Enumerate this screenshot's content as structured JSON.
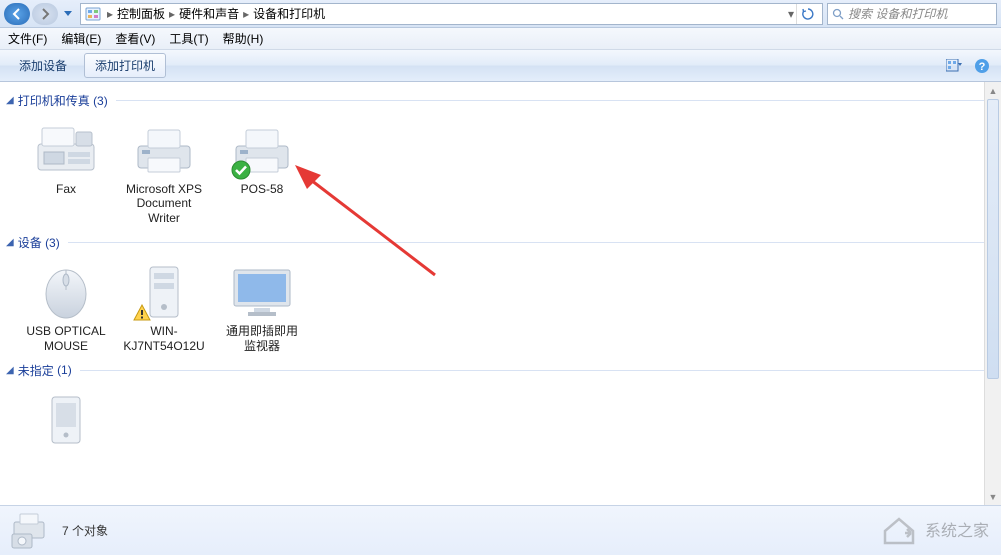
{
  "titlebar": {
    "breadcrumbs": [
      "控制面板",
      "硬件和声音",
      "设备和打印机"
    ],
    "search_placeholder": "搜索 设备和打印机"
  },
  "menubar": {
    "file": "文件(F)",
    "edit": "编辑(E)",
    "view": "查看(V)",
    "tools": "工具(T)",
    "help": "帮助(H)"
  },
  "toolbar": {
    "add_device": "添加设备",
    "add_printer": "添加打印机"
  },
  "groups": {
    "printers": {
      "title": "打印机和传真",
      "count": "(3)"
    },
    "devices": {
      "title": "设备",
      "count": "(3)"
    },
    "unspecified": {
      "title": "未指定",
      "count": "(1)"
    }
  },
  "items": {
    "printers": [
      {
        "label": "Fax",
        "icon": "fax",
        "default": false
      },
      {
        "label": "Microsoft XPS Document Writer",
        "icon": "printer",
        "default": false
      },
      {
        "label": "POS-58",
        "icon": "printer",
        "default": true
      }
    ],
    "devices": [
      {
        "label": "USB OPTICAL MOUSE",
        "icon": "mouse",
        "warn": false
      },
      {
        "label": "WIN-KJ7NT54O12U",
        "icon": "pc",
        "warn": true
      },
      {
        "label": "通用即插即用监视器",
        "icon": "monitor",
        "warn": false
      }
    ],
    "unspecified": [
      {
        "label": "",
        "icon": "device",
        "warn": false
      }
    ]
  },
  "statusbar": {
    "count_text": "7 个对象"
  },
  "watermark": {
    "text": "系统之家"
  },
  "icons": {
    "back": "back-icon",
    "forward": "forward-icon",
    "dropdown": "chevron-down-icon",
    "control_panel": "control-panel-icon",
    "refresh": "refresh-icon",
    "search": "search-icon",
    "view_mode": "view-mode-icon",
    "help": "help-icon"
  }
}
